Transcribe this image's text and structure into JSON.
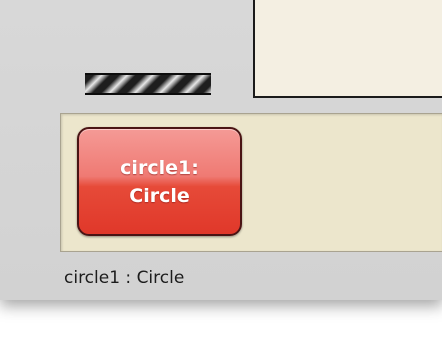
{
  "object_button": {
    "line1": "circle1:",
    "line2": "Circle",
    "color": "#e64a38"
  },
  "status_bar": {
    "text": "circle1 : Circle"
  },
  "canvas": {
    "background": "#f4efe2"
  },
  "tray": {
    "background": "#ece6cc"
  }
}
